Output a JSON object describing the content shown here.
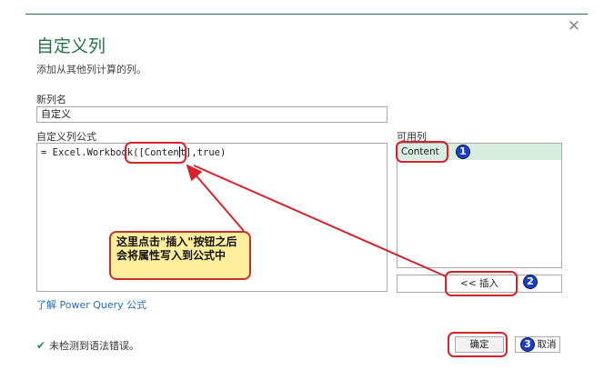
{
  "dialog": {
    "title": "自定义列",
    "subtitle": "添加从其他列计算的列。",
    "close_glyph": "✕"
  },
  "new_column": {
    "label": "新列名",
    "value": "自定义"
  },
  "formula": {
    "label": "自定义列公式",
    "prefix": "= Excel.Workbook(",
    "before_cursor": "[Conten",
    "after_cursor": "t]",
    "suffix": ",true)"
  },
  "available_columns": {
    "label": "可用列",
    "items": [
      "Content"
    ]
  },
  "buttons": {
    "insert": "<< 插入",
    "ok": "确定",
    "cancel": "取消"
  },
  "learn_link": "了解 Power Query 公式",
  "status": {
    "text": "未检测到语法错误。",
    "icon": "check-icon"
  },
  "annotation": {
    "callout_text": "这里点击\"插入\"按钮之后会将属性写入到公式中",
    "badges": [
      "1",
      "2",
      "3"
    ],
    "highlight_color": "#d4232a",
    "badge_color": "#1d3fbf"
  },
  "colors": {
    "accent": "#217346",
    "link": "#1f6fb5",
    "selected_row": "#d9ede1"
  }
}
